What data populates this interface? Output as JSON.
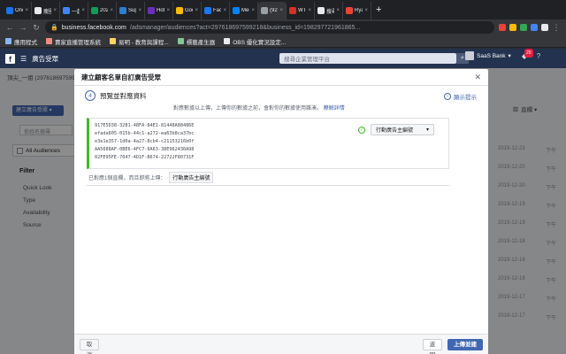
{
  "browser": {
    "tabs": [
      {
        "label": "One",
        "color": "#1a73e8"
      },
      {
        "label": "瘦圈",
        "color": "#e8eaed"
      },
      {
        "label": "一起",
        "color": "#4285f4"
      },
      {
        "label": "202",
        "color": "#0f9d58"
      },
      {
        "label": "Sup",
        "color": "#2e7dd1"
      },
      {
        "label": "Hotj",
        "color": "#6b2fbb"
      },
      {
        "label": "Goo",
        "color": "#fbbc05"
      },
      {
        "label": "Face",
        "color": "#1877f2"
      },
      {
        "label": "Mess",
        "color": "#0084ff"
      },
      {
        "label": "(92)",
        "color": "#9aa0a6"
      },
      {
        "label": "WT",
        "color": "#d93025"
      },
      {
        "label": "搜尋",
        "color": "#e8eaed"
      },
      {
        "label": "Ryan",
        "color": "#ea4335"
      }
    ],
    "active_tab_index": 9,
    "url_host": "business.facebook.com",
    "url_rest": "/adsmanager/audiences?act=297618697599218&business_id=198297721961865...",
    "bookmarks": [
      {
        "label": "應用程式",
        "color": "#8ab4f8"
      },
      {
        "label": "賣家直播管理系統",
        "color": "#f28b82"
      },
      {
        "label": "易明 - 教育與課程...",
        "color": "#fdd663"
      },
      {
        "label": "標籤產生器",
        "color": "#81c995"
      },
      {
        "label": "OBS 優化實況設定...",
        "color": "#e8eaed"
      }
    ]
  },
  "fb": {
    "logo": "f",
    "section": "廣告受眾",
    "search_placeholder": "搜尋企業管理平台",
    "account": "SaaS Bank",
    "notif_count": "20"
  },
  "bg": {
    "crumb": "頂尖_一姐 (297618697599218)",
    "create_btn": "建立廣告受眾 ▾",
    "search_placeholder": "依姓名搜尋",
    "all_audiences": "All Audiences",
    "filter_title": "Filter",
    "filters": [
      "Quick Look",
      "Type",
      "Availability",
      "Source"
    ],
    "columns_btn": "直欄 ▾",
    "dates": [
      "2019-12-23",
      "2019-12-20",
      "2019-12-20",
      "2019-12-19",
      "2019-12-19",
      "2019-12-18",
      "2019-12-18",
      "2019-12-18",
      "2019-12-17",
      "2019-12-17"
    ],
    "next_label": "下午"
  },
  "modal": {
    "title": "建立顧客名單自訂廣告受眾",
    "step_number": "4",
    "step_title": "預覽並對應資料",
    "tips_label": "顯示提示",
    "description": "對應數據以上傳，上傳你的數據之前，會對你的數據使用雜湊。",
    "learn_more": "瞭解詳情",
    "ids": [
      "917E5D38-3281-48FA-84E1-81448A88486E",
      "efada605-015b-44c1-a272-ea63b8ca37bc",
      "e3e1e357-1d0a-4a27-8cb4-c21153216b0f",
      "AA5688AF-0BE6-4FC7-9A63-38E962430A98",
      "02FE95FE-7047-4D1F-B674-22722F80731F"
    ],
    "mapping_select": "行動廣告主編號",
    "summary_prefix": "已對應1個直欄，而且即將上傳：",
    "summary_tag": "行動廣告主編號",
    "cancel": "取消",
    "back": "返回",
    "upload": "上傳並建立"
  },
  "colors": {
    "fb_header": "#23324f",
    "primary": "#4267b2",
    "success": "#42b72a"
  }
}
